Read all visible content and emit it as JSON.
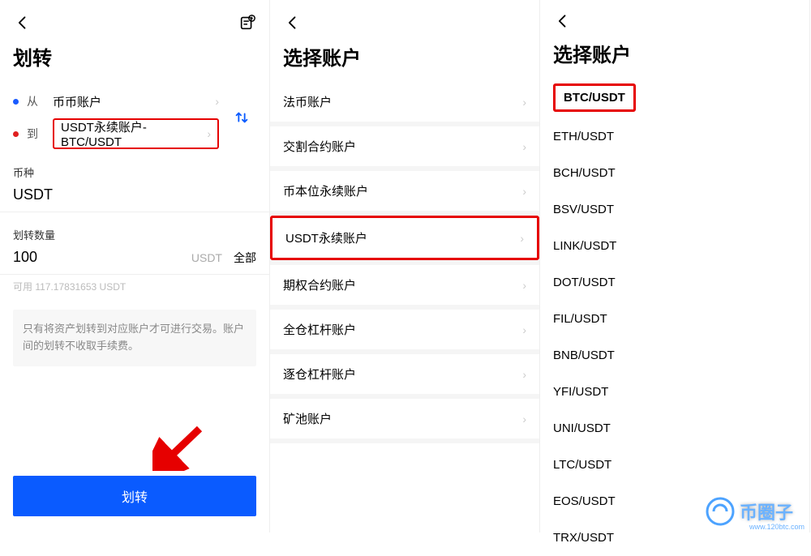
{
  "panel1": {
    "title": "划转",
    "from_label": "从",
    "from_value": "币币账户",
    "to_label": "到",
    "to_value": "USDT永续账户-BTC/USDT",
    "currency_label": "币种",
    "currency_value": "USDT",
    "amount_label": "划转数量",
    "amount_value": "100",
    "amount_unit": "USDT",
    "all_btn": "全部",
    "available": "可用 117.17831653 USDT",
    "notice": "只有将资产划转到对应账户才可进行交易。账户间的划转不收取手续费。",
    "submit_btn": "划转"
  },
  "panel2": {
    "title": "选择账户",
    "items": [
      "法币账户",
      "交割合约账户",
      "币本位永续账户",
      "USDT永续账户",
      "期权合约账户",
      "全仓杠杆账户",
      "逐仓杠杆账户",
      "矿池账户"
    ],
    "highlight_index": 3
  },
  "panel3": {
    "title": "选择账户",
    "items": [
      "BTC/USDT",
      "ETH/USDT",
      "BCH/USDT",
      "BSV/USDT",
      "LINK/USDT",
      "DOT/USDT",
      "FIL/USDT",
      "BNB/USDT",
      "YFI/USDT",
      "UNI/USDT",
      "LTC/USDT",
      "EOS/USDT",
      "TRX/USDT"
    ],
    "highlight_index": 0
  },
  "watermark": {
    "brand": "币圈子",
    "url": "www.120btc.com"
  }
}
